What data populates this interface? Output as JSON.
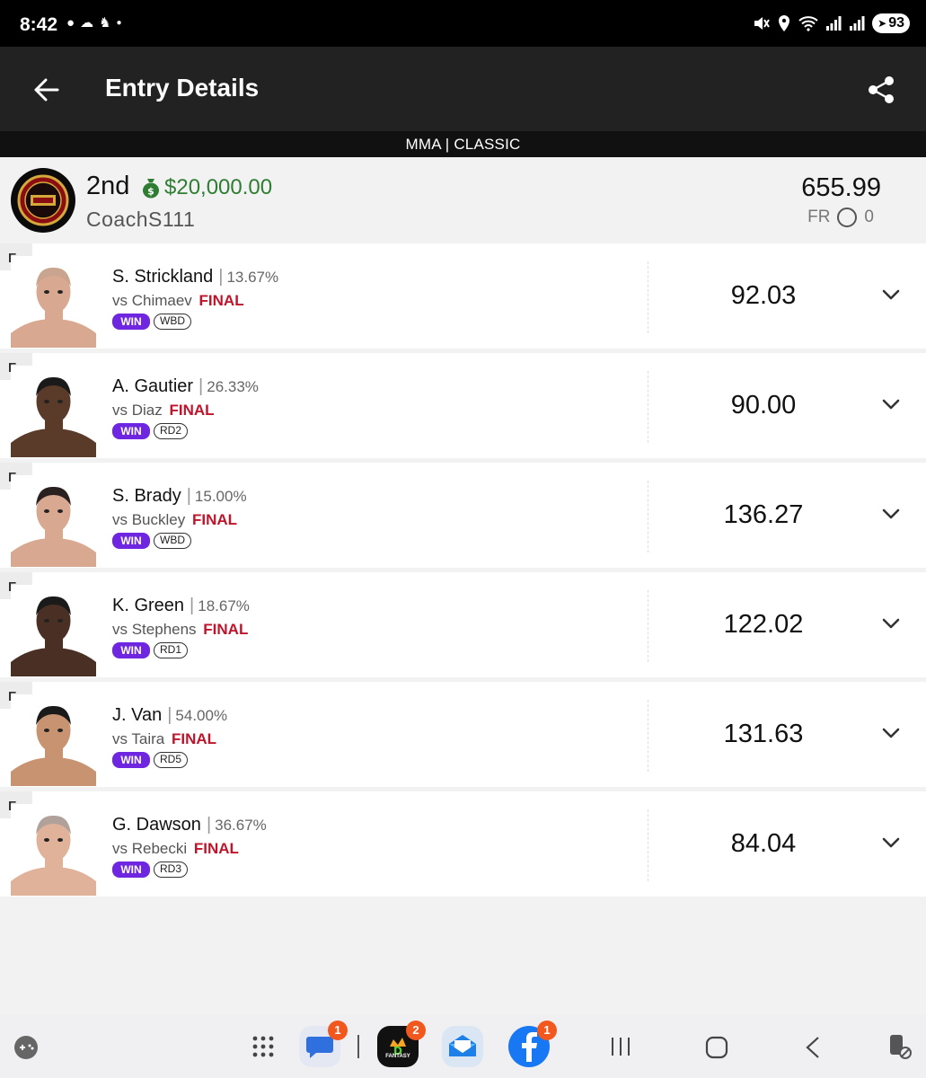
{
  "status_bar": {
    "time": "8:42",
    "battery": "93"
  },
  "header": {
    "title": "Entry Details"
  },
  "contest_type": "MMA | CLASSIC",
  "summary": {
    "rank": "2nd",
    "prize": "$20,000.00",
    "username": "CoachS111",
    "total_points": "655.99",
    "fr_label": "FR",
    "fr_value": "0"
  },
  "fighters": [
    {
      "position": "F",
      "name": "S. Strickland",
      "ownership": "13.67%",
      "opponent": "vs Chimaev",
      "status": "FINAL",
      "result": "WIN",
      "method": "WBD",
      "points": "92.03"
    },
    {
      "position": "F",
      "name": "A. Gautier",
      "ownership": "26.33%",
      "opponent": "vs Diaz",
      "status": "FINAL",
      "result": "WIN",
      "method": "RD2",
      "points": "90.00"
    },
    {
      "position": "F",
      "name": "S. Brady",
      "ownership": "15.00%",
      "opponent": "vs Buckley",
      "status": "FINAL",
      "result": "WIN",
      "method": "WBD",
      "points": "136.27"
    },
    {
      "position": "F",
      "name": "K. Green",
      "ownership": "18.67%",
      "opponent": "vs Stephens",
      "status": "FINAL",
      "result": "WIN",
      "method": "RD1",
      "points": "122.02"
    },
    {
      "position": "F",
      "name": "J. Van",
      "ownership": "54.00%",
      "opponent": "vs Taira",
      "status": "FINAL",
      "result": "WIN",
      "method": "RD5",
      "points": "131.63"
    },
    {
      "position": "F",
      "name": "G. Dawson",
      "ownership": "36.67%",
      "opponent": "vs Rebecki",
      "status": "FINAL",
      "result": "WIN",
      "method": "RD3",
      "points": "84.04"
    }
  ],
  "navbar": {
    "messages_badge": "1",
    "fantasy_badge": "2",
    "fantasy_label": "FANTASY",
    "facebook_badge": "1"
  },
  "colors": {
    "accent_win": "#6f26e0",
    "final_red": "#c0142b",
    "prize_green": "#2e7d32"
  }
}
